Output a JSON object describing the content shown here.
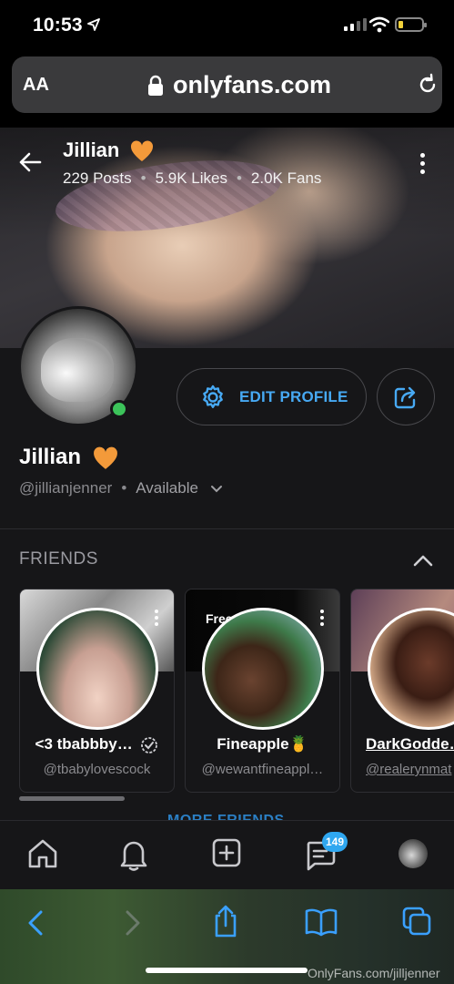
{
  "status": {
    "time": "10:53"
  },
  "browser": {
    "aa_label": "AA",
    "domain": "onlyfans.com"
  },
  "cover": {
    "name": "Jillian",
    "posts": "229 Posts",
    "likes": "5.9K Likes",
    "fans": "2.0K Fans",
    "dot": "•"
  },
  "actions": {
    "edit_profile": "EDIT PROFILE"
  },
  "profile": {
    "name": "Jillian",
    "handle": "@jillianjenner",
    "dot": "•",
    "availability": "Available"
  },
  "friends": {
    "title": "FRIENDS",
    "items": [
      {
        "name": "<3 tbabbby…",
        "handle": "@tbabylovescock",
        "verified": true,
        "free": ""
      },
      {
        "name": "Fineapple🍍",
        "handle": "@wewantfineappl…",
        "verified": false,
        "free": "Free"
      },
      {
        "name": "DarkGodde…",
        "handle": "@realerynmat",
        "verified": false,
        "free": ""
      }
    ],
    "more": "MORE FRIENDS"
  },
  "nav": {
    "messages_badge": "149"
  },
  "watermark": "OnlyFans.com/jilljenner",
  "colors": {
    "accent": "#00aff0",
    "online": "#3cc35a",
    "heart": "#f39a3a"
  }
}
